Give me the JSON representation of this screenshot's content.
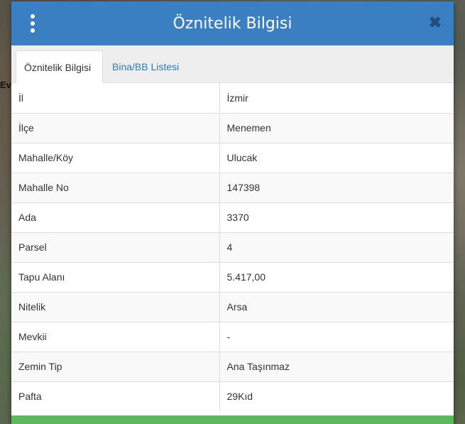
{
  "map": {
    "label": "Ev"
  },
  "dialog": {
    "title": "Öznitelik Bilgisi",
    "menu_icon": "kebab-menu-icon",
    "close_icon": "close-icon",
    "close_glyph": "✖"
  },
  "tabs": [
    {
      "label": "Öznitelik Bilgisi",
      "active": true
    },
    {
      "label": "Bina/BB Listesi",
      "active": false
    }
  ],
  "attributes": [
    {
      "key": "İl",
      "value": "İzmir"
    },
    {
      "key": "İlçe",
      "value": "Menemen"
    },
    {
      "key": "Mahalle/Köy",
      "value": "Ulucak"
    },
    {
      "key": "Mahalle No",
      "value": "147398"
    },
    {
      "key": "Ada",
      "value": "3370"
    },
    {
      "key": "Parsel",
      "value": "4"
    },
    {
      "key": "Tapu Alanı",
      "value": "5.417,00"
    },
    {
      "key": "Nitelik",
      "value": "Arsa"
    },
    {
      "key": "Mevkii",
      "value": "-"
    },
    {
      "key": "Zemin Tip",
      "value": "Ana Taşınmaz"
    },
    {
      "key": "Pafta",
      "value": "29Kıd"
    }
  ],
  "colors": {
    "header": "#3a7fc2",
    "tab_link": "#337ab7",
    "footer": "#5cb85c"
  }
}
